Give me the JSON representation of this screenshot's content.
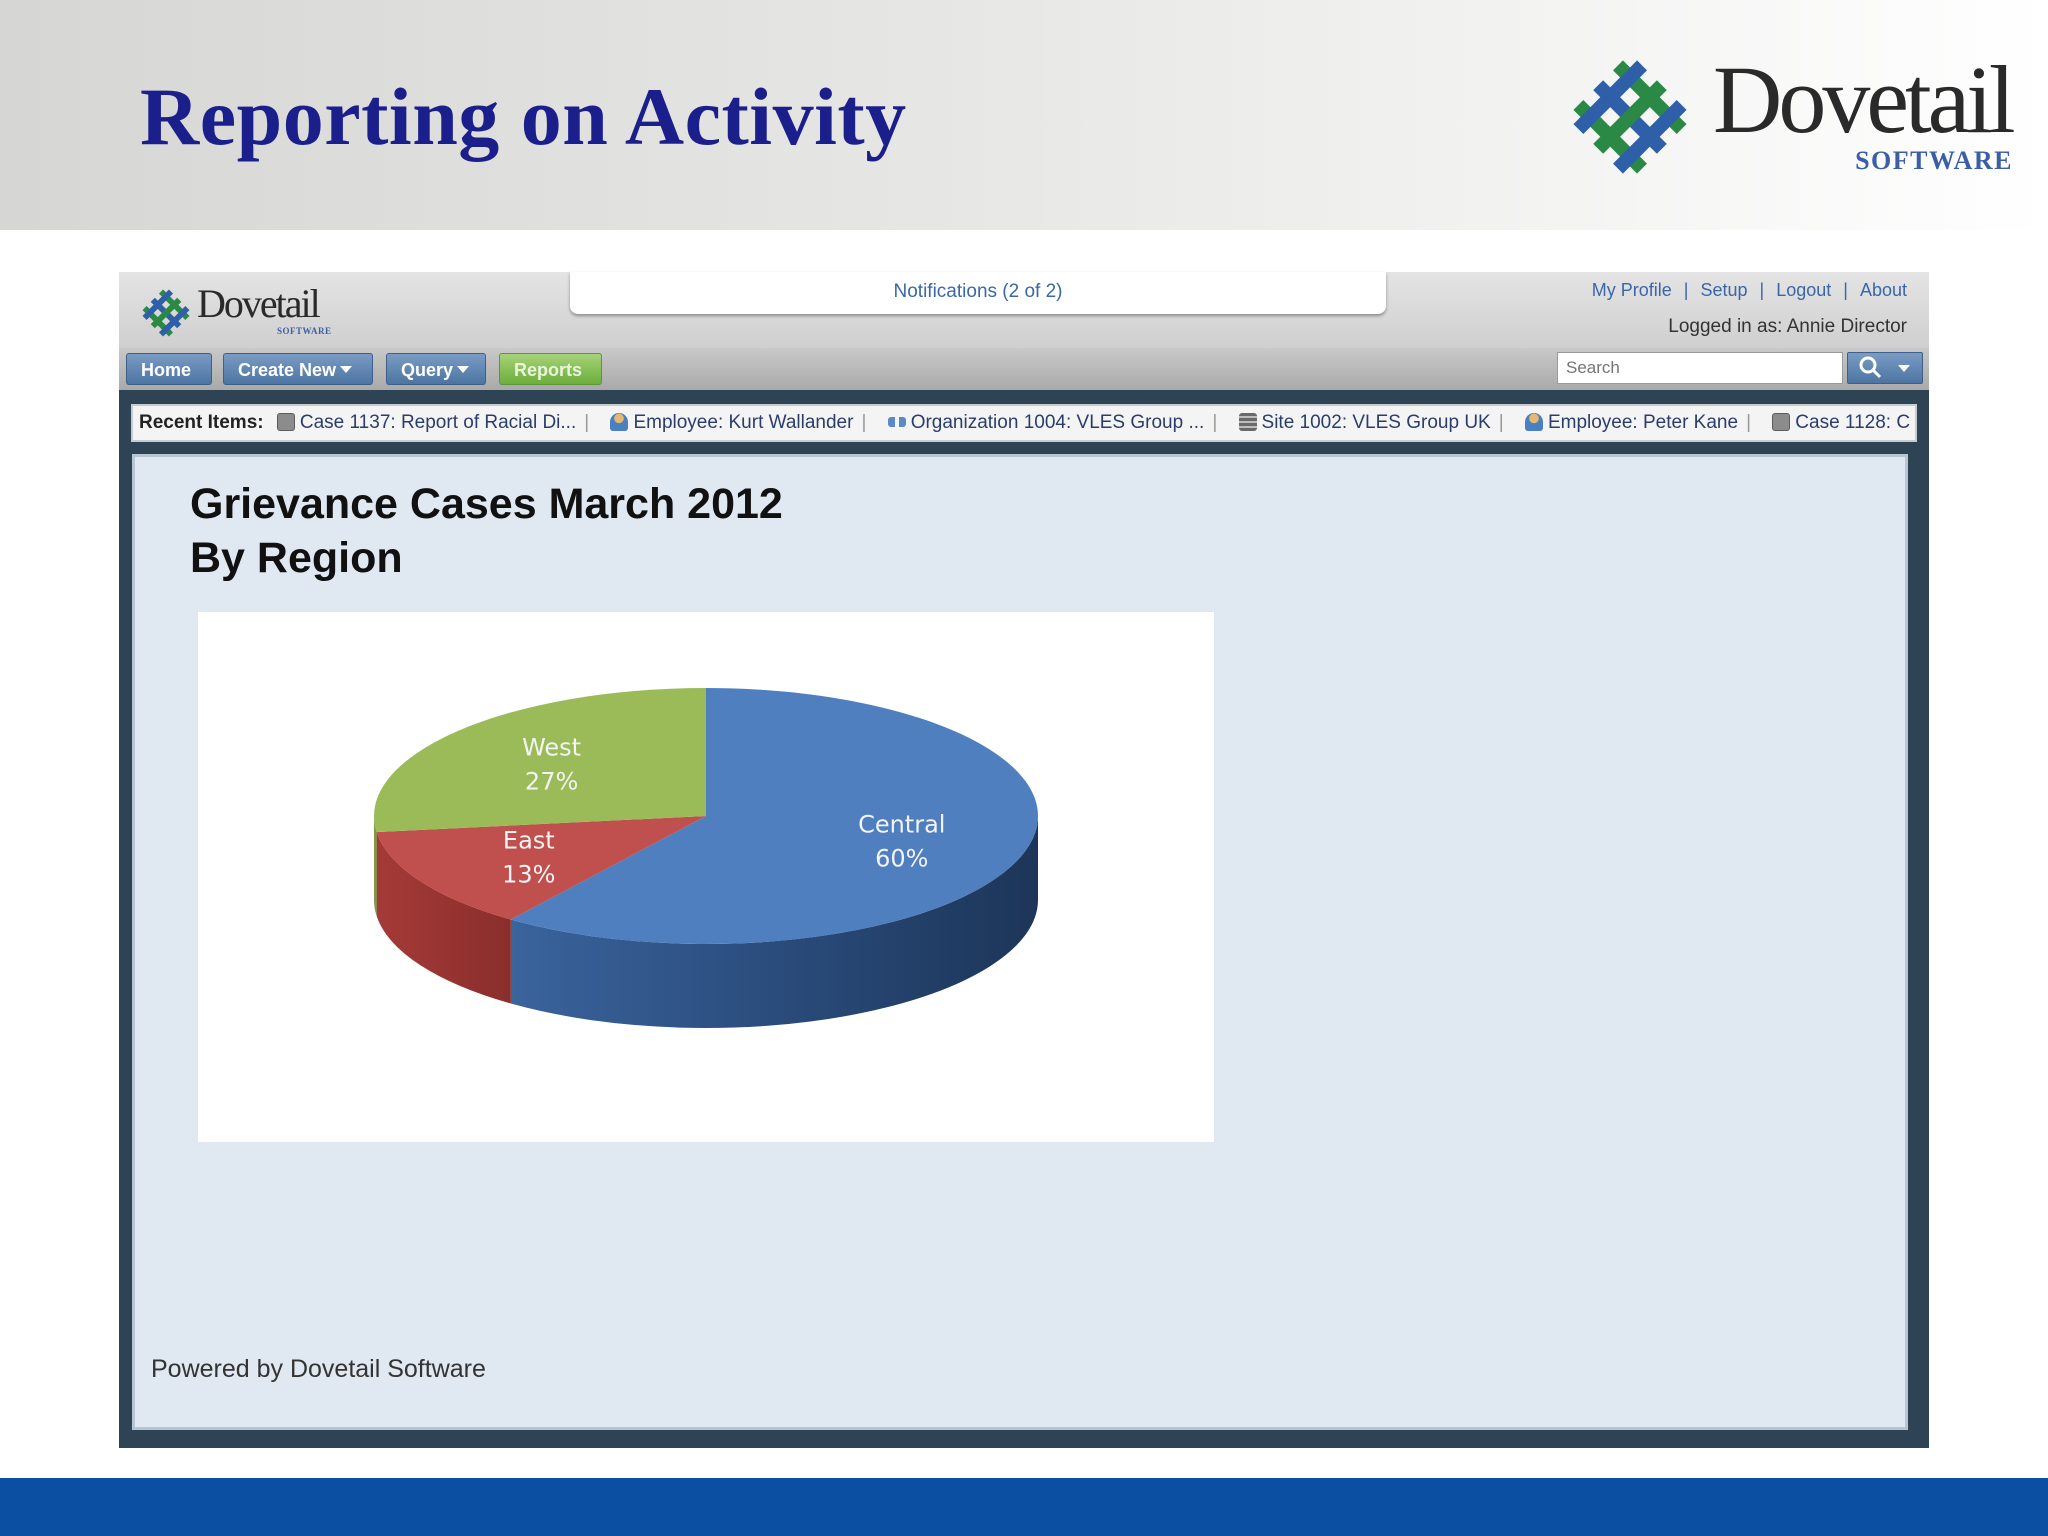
{
  "slide": {
    "title": "Reporting on Activity",
    "logo_word": "Dovetail",
    "logo_sub": "SOFTWARE"
  },
  "app": {
    "logo_word": "Dovetail",
    "logo_sub": "SOFTWARE",
    "notifications": "Notifications (2 of 2)",
    "top_links": [
      "My Profile",
      "Setup",
      "Logout",
      "About"
    ],
    "logged_in": "Logged in as: Annie Director",
    "nav": {
      "home": "Home",
      "create_new": "Create New",
      "query": "Query",
      "reports": "Reports"
    },
    "search": {
      "placeholder": "Search"
    },
    "recent": {
      "label": "Recent Items:",
      "items": [
        {
          "icon": "case-icon",
          "text": "Case 1137: Report of Racial Di..."
        },
        {
          "icon": "employee-icon",
          "text": "Employee: Kurt Wallander"
        },
        {
          "icon": "organization-icon",
          "text": "Organization 1004: VLES Group ..."
        },
        {
          "icon": "site-icon",
          "text": "Site 1002: VLES Group UK"
        },
        {
          "icon": "employee-icon",
          "text": "Employee: Peter Kane"
        },
        {
          "icon": "case-icon",
          "text": "Case 1128: C"
        }
      ]
    },
    "report": {
      "title_line1": "Grievance Cases March 2012",
      "title_line2": "By Region"
    },
    "powered_by": "Powered by Dovetail Software"
  },
  "colors": {
    "title": "#1b1f8c",
    "bottom_band": "#0b4fa3",
    "central": "#4f7fbf",
    "east": "#c0504d",
    "west": "#9bbb59"
  },
  "chart_data": {
    "type": "pie",
    "title": "",
    "categories": [
      "Central",
      "East",
      "West"
    ],
    "values": [
      60,
      13,
      27
    ],
    "labels": [
      "Central\n60%",
      "East\n13%",
      "West\n27%"
    ],
    "style": "3d"
  }
}
